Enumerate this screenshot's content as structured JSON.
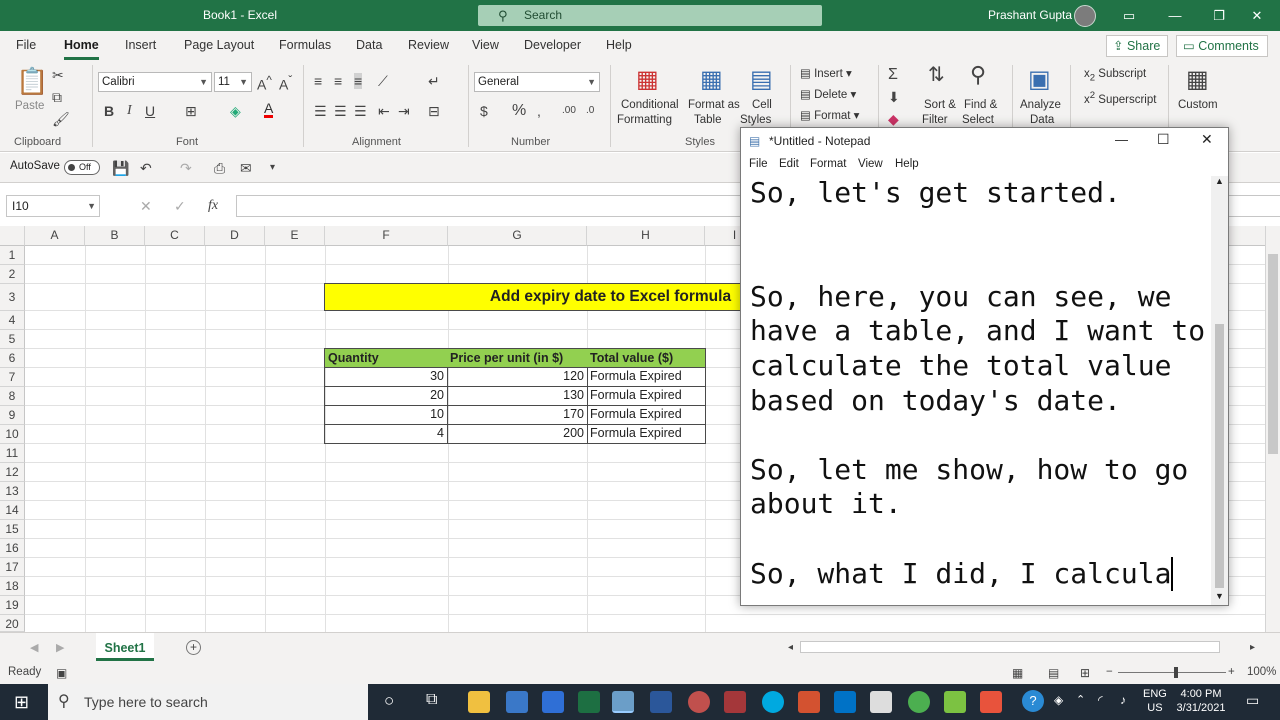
{
  "window": {
    "title": "Book1  -  Excel",
    "search_placeholder": "Search",
    "user_name": "Prashant Gupta"
  },
  "tabs": [
    "File",
    "Home",
    "Insert",
    "Page Layout",
    "Formulas",
    "Data",
    "Review",
    "View",
    "Developer",
    "Help"
  ],
  "share_label": "Share",
  "comments_label": "Comments",
  "ribbon": {
    "clipboard": {
      "paste": "Paste",
      "label": "Clipboard"
    },
    "font": {
      "name": "Calibri",
      "size": "11",
      "label": "Font",
      "bold": "B",
      "italic": "I",
      "underline": "U"
    },
    "alignment": {
      "label": "Alignment"
    },
    "number": {
      "format": "General",
      "label": "Number",
      "currency": "$",
      "percent": "%"
    },
    "styles": {
      "conditional": "Conditional",
      "conditional2": "Formatting",
      "format_as": "Format as",
      "format_as2": "Table",
      "cell": "Cell",
      "cell2": "Styles",
      "label": "Styles"
    },
    "cells": {
      "insert": "Insert",
      "delete": "Delete",
      "format": "Format"
    },
    "editing": {
      "sort": "Sort &",
      "sort2": "Filter",
      "find": "Find &",
      "find2": "Select",
      "sigma": "Σ"
    },
    "analysis": {
      "analyze": "Analyze",
      "analyze2": "Data"
    },
    "custom": {
      "subscript": "Subscript",
      "superscript": "Superscript",
      "custom": "Custom"
    }
  },
  "qat": {
    "autosave": "AutoSave",
    "toggle": "Off"
  },
  "formula_bar": {
    "name_box": "I10",
    "fx": "fx",
    "value": ""
  },
  "columns": [
    "A",
    "B",
    "C",
    "D",
    "E",
    "F",
    "G",
    "H",
    "I"
  ],
  "rows": [
    "1",
    "2",
    "3",
    "4",
    "5",
    "6",
    "7",
    "8",
    "9",
    "10",
    "11",
    "12",
    "13",
    "14",
    "15",
    "16",
    "17",
    "18",
    "19",
    "20"
  ],
  "sheet": {
    "title_banner": "Add expiry date to Excel formula",
    "headers": [
      "Quantity",
      "Price per unit (in $)",
      "Total value ($)"
    ],
    "data": [
      {
        "qty": "30",
        "price": "120",
        "total": "Formula Expired"
      },
      {
        "qty": "20",
        "price": "130",
        "total": "Formula Expired"
      },
      {
        "qty": "10",
        "price": "170",
        "total": "Formula Expired"
      },
      {
        "qty": "4",
        "price": "200",
        "total": "Formula Expired"
      }
    ]
  },
  "sheet_tabs": [
    "Sheet1"
  ],
  "status": {
    "ready": "Ready",
    "zoom": "100%"
  },
  "notepad": {
    "title": "*Untitled - Notepad",
    "menu": [
      "File",
      "Edit",
      "Format",
      "View",
      "Help"
    ],
    "lines": [
      "So, let's get started.",
      "",
      "",
      "So, here, you can see, we",
      "have a table, and I want to",
      "calculate the total value",
      "based on today's date.",
      "",
      "So, let me show, how to go",
      "about it.",
      "",
      "So, what I did, I calcula"
    ]
  },
  "taskbar": {
    "search_placeholder": "Type here to search",
    "lang1": "ENG",
    "lang2": "US",
    "time": "4:00 PM",
    "date": "3/31/2021"
  },
  "colors": {
    "excel_green": "#217346",
    "banner_yellow": "#ffff00",
    "header_green": "#92d050"
  }
}
